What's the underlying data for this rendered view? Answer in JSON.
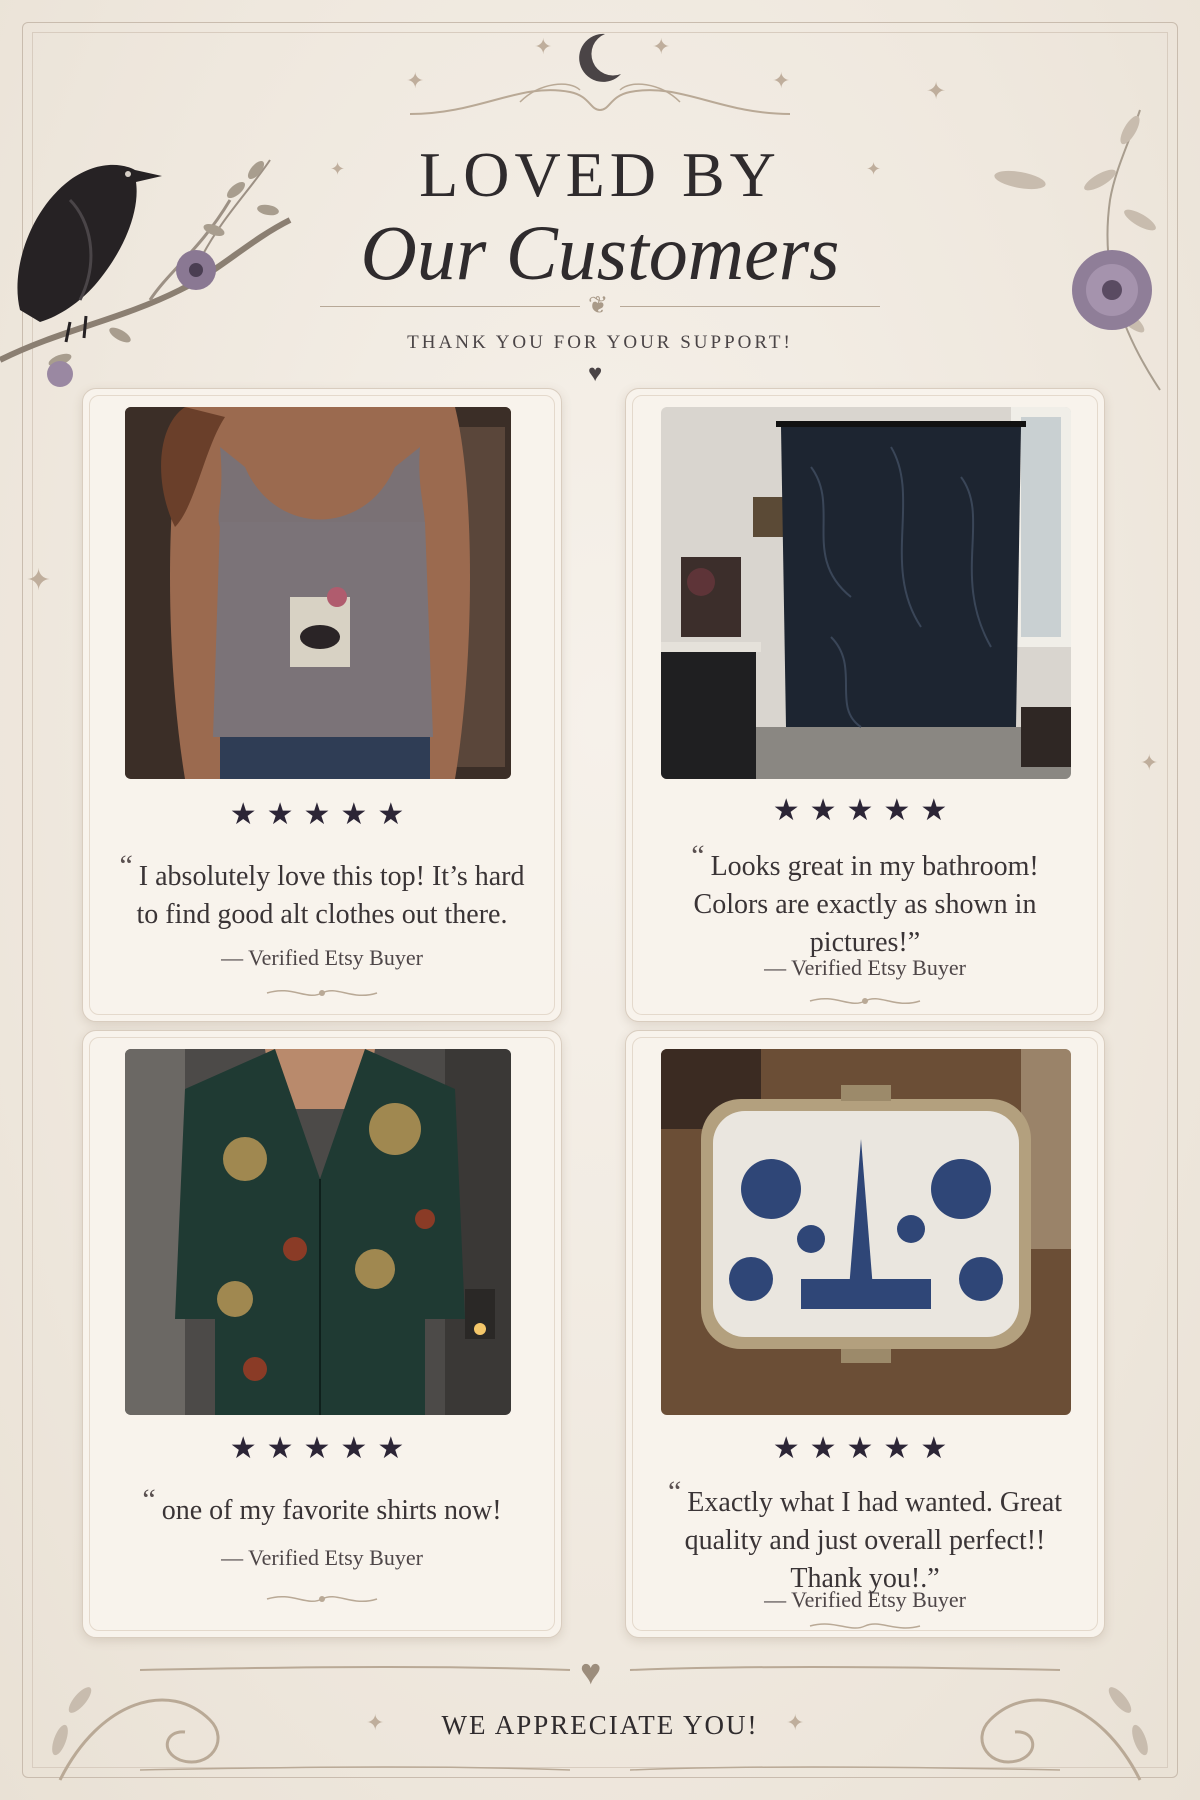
{
  "header": {
    "title_line1": "LOVED BY",
    "title_line2": "Our Customers",
    "subtitle": "THANK YOU FOR YOUR SUPPORT!"
  },
  "reviews": [
    {
      "stars": "★★★★★",
      "quote": "I absolutely love this top! It’s hard to find good alt clothes out there.",
      "buyer": "— Verified Etsy Buyer",
      "photo": "grey-tank-top-raven-print"
    },
    {
      "stars": "★★★★★",
      "quote": "Looks great in my bathroom! Colors are exactly as shown in pictures!”",
      "buyer": "— Verified Etsy Buyer",
      "photo": "dark-botanical-shower-curtain"
    },
    {
      "stars": "★★★★★",
      "quote": "one of my favorite shirts now!",
      "buyer": "— Verified Etsy Buyer",
      "photo": "dark-floral-button-shirt"
    },
    {
      "stars": "★★★★★",
      "quote": "Exactly what I had wanted. Great quality and just overall perfect!! Thank you!.”",
      "buyer": "— Verified Etsy Buyer",
      "photo": "blue-toile-pill-case"
    }
  ],
  "footer": {
    "text": "WE APPRECIATE YOU!"
  },
  "colors": {
    "background": "#f1ebe2",
    "card": "#f8f3ec",
    "ink": "#2f2b2d",
    "star": "#2c2536",
    "floral_purple": "#8a7893"
  },
  "icons": [
    "moon-icon",
    "raven-illustration",
    "flower-icon",
    "heart-icon",
    "sparkle-icon"
  ]
}
